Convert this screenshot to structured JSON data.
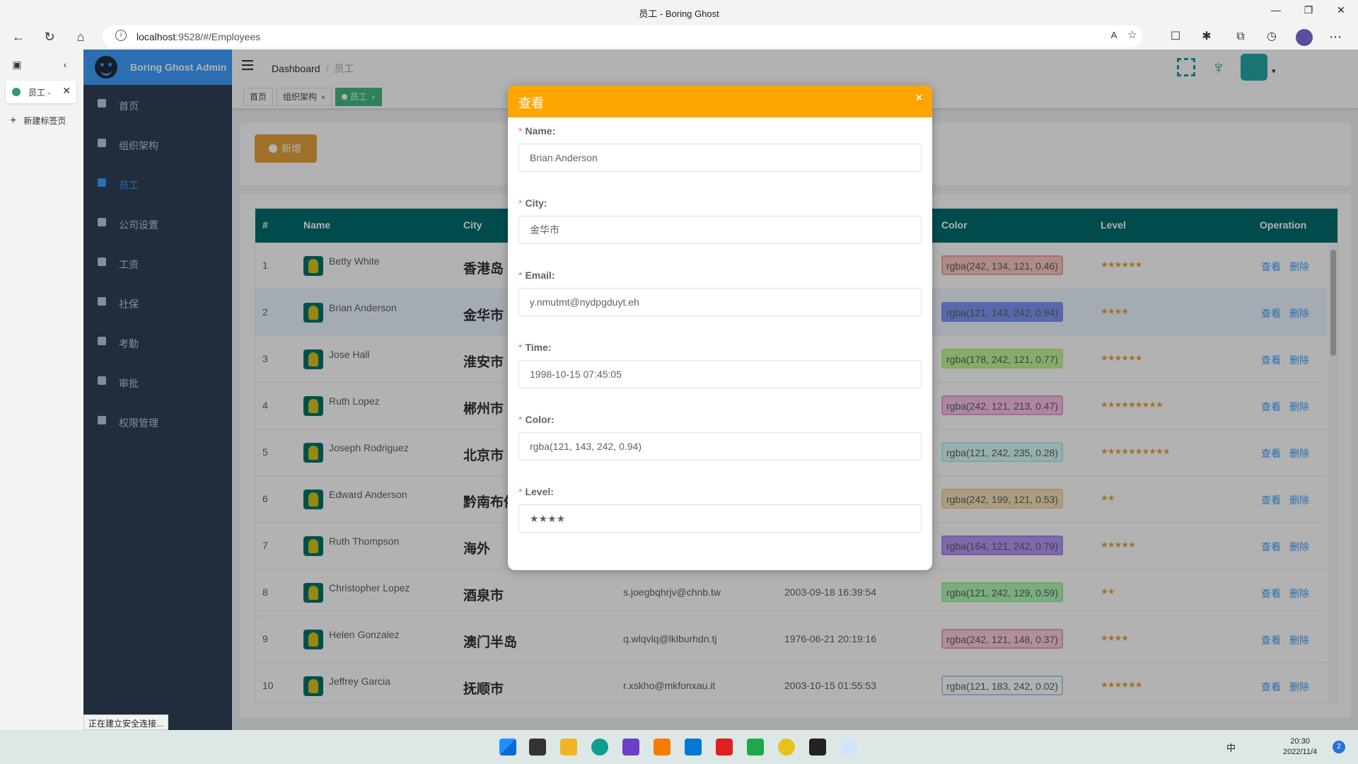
{
  "browser": {
    "window_title": "员工 - Boring Ghost",
    "url_host": "localhost",
    "url_rest": ":9528/#/Employees",
    "tab_label": "员工 -",
    "new_tab_label": "新建标签页",
    "status_text": "正在建立安全连接..."
  },
  "sidebar": {
    "app_name": "Boring Ghost Admin",
    "items": [
      {
        "label": "首页",
        "icon": "dashboard-icon",
        "active": false
      },
      {
        "label": "组织架构",
        "icon": "tree-icon",
        "active": false
      },
      {
        "label": "员工",
        "icon": "people-icon",
        "active": true
      },
      {
        "label": "公司设置",
        "icon": "setting-icon",
        "active": false
      },
      {
        "label": "工资",
        "icon": "money-icon",
        "active": false
      },
      {
        "label": "社保",
        "icon": "table-icon",
        "active": false
      },
      {
        "label": "考勤",
        "icon": "skill-icon",
        "active": false
      },
      {
        "label": "审批",
        "icon": "user-icon",
        "active": false
      },
      {
        "label": "权限管理",
        "icon": "lock-icon",
        "active": false
      }
    ]
  },
  "navbar": {
    "breadcrumb": [
      "Dashboard",
      "员工"
    ]
  },
  "tags": [
    {
      "label": "首页",
      "closable": false,
      "active": false
    },
    {
      "label": "组织架构",
      "closable": true,
      "active": false
    },
    {
      "label": "员工",
      "closable": true,
      "active": true
    }
  ],
  "toolbar": {
    "add_label": "新增"
  },
  "table": {
    "columns": [
      "#",
      "Name",
      "City",
      "Color",
      "Level",
      "Operation"
    ],
    "view_label": "查看",
    "delete_label": "删除",
    "rows": [
      {
        "idx": "1",
        "name": "Betty White",
        "city": "香港岛",
        "email": "",
        "time": "",
        "color": "rgba(242, 134, 121, 0.46)",
        "level": "★★★★★★",
        "highlight": false
      },
      {
        "idx": "2",
        "name": "Brian Anderson",
        "city": "金华市",
        "email": "",
        "time": "",
        "color": "rgba(121, 143, 242, 0.94)",
        "level": "★★★★",
        "highlight": true
      },
      {
        "idx": "3",
        "name": "Jose Hall",
        "city": "淮安市",
        "email": "",
        "time": "",
        "color": "rgba(178, 242, 121, 0.77)",
        "level": "★★★★★★",
        "highlight": false
      },
      {
        "idx": "4",
        "name": "Ruth Lopez",
        "city": "郴州市",
        "email": "",
        "time": "",
        "color": "rgba(242, 121, 213, 0.47)",
        "level": "★★★★★★★★★",
        "highlight": false
      },
      {
        "idx": "5",
        "name": "Joseph Rodriguez",
        "city": "北京市",
        "email": "",
        "time": "",
        "color": "rgba(121, 242, 235, 0.28)",
        "level": "★★★★★★★★★★",
        "highlight": false
      },
      {
        "idx": "6",
        "name": "Edward Anderson",
        "city": "黔南布依",
        "email": "",
        "time": "",
        "color": "rgba(242, 199, 121, 0.53)",
        "level": "★★",
        "highlight": false
      },
      {
        "idx": "7",
        "name": "Ruth Thompson",
        "city": "海外",
        "email": "",
        "time": "",
        "color": "rgba(164, 121, 242, 0.79)",
        "level": "★★★★★",
        "highlight": false
      },
      {
        "idx": "8",
        "name": "Christopher Lopez",
        "city": "酒泉市",
        "email": "s.joegbqhrjv@chnb.tw",
        "time": "2003-09-18 16:39:54",
        "color": "rgba(121, 242, 129, 0.59)",
        "level": "★★",
        "highlight": false
      },
      {
        "idx": "9",
        "name": "Helen Gonzalez",
        "city": "澳门半岛",
        "email": "q.wlqvlq@lklburhdn.tj",
        "time": "1976-06-21 20:19:16",
        "color": "rgba(242, 121, 148, 0.37)",
        "level": "★★★★",
        "highlight": false
      },
      {
        "idx": "10",
        "name": "Jeffrey Garcia",
        "city": "抚顺市",
        "email": "r.xskho@mkfonxau.it",
        "time": "2003-10-15 01:55:53",
        "color": "rgba(121, 183, 242, 0.02)",
        "level": "★★★★★★",
        "highlight": false
      }
    ]
  },
  "dialog": {
    "title": "查看",
    "close": "×",
    "fields": [
      {
        "label": "Name:",
        "value": "Brian Anderson"
      },
      {
        "label": "City:",
        "value": "金华市"
      },
      {
        "label": "Email:",
        "value": "y.nmutmt@nydpgduyt.eh"
      },
      {
        "label": "Time:",
        "value": "1998-10-15 07:45:05"
      },
      {
        "label": "Color:",
        "value": "rgba(121, 143, 242, 0.94)"
      },
      {
        "label": "Level:",
        "value": "★★★★"
      }
    ]
  },
  "taskbar": {
    "ime": "中",
    "time": "20:30",
    "date": "2022/11/4",
    "notification_count": "2"
  }
}
